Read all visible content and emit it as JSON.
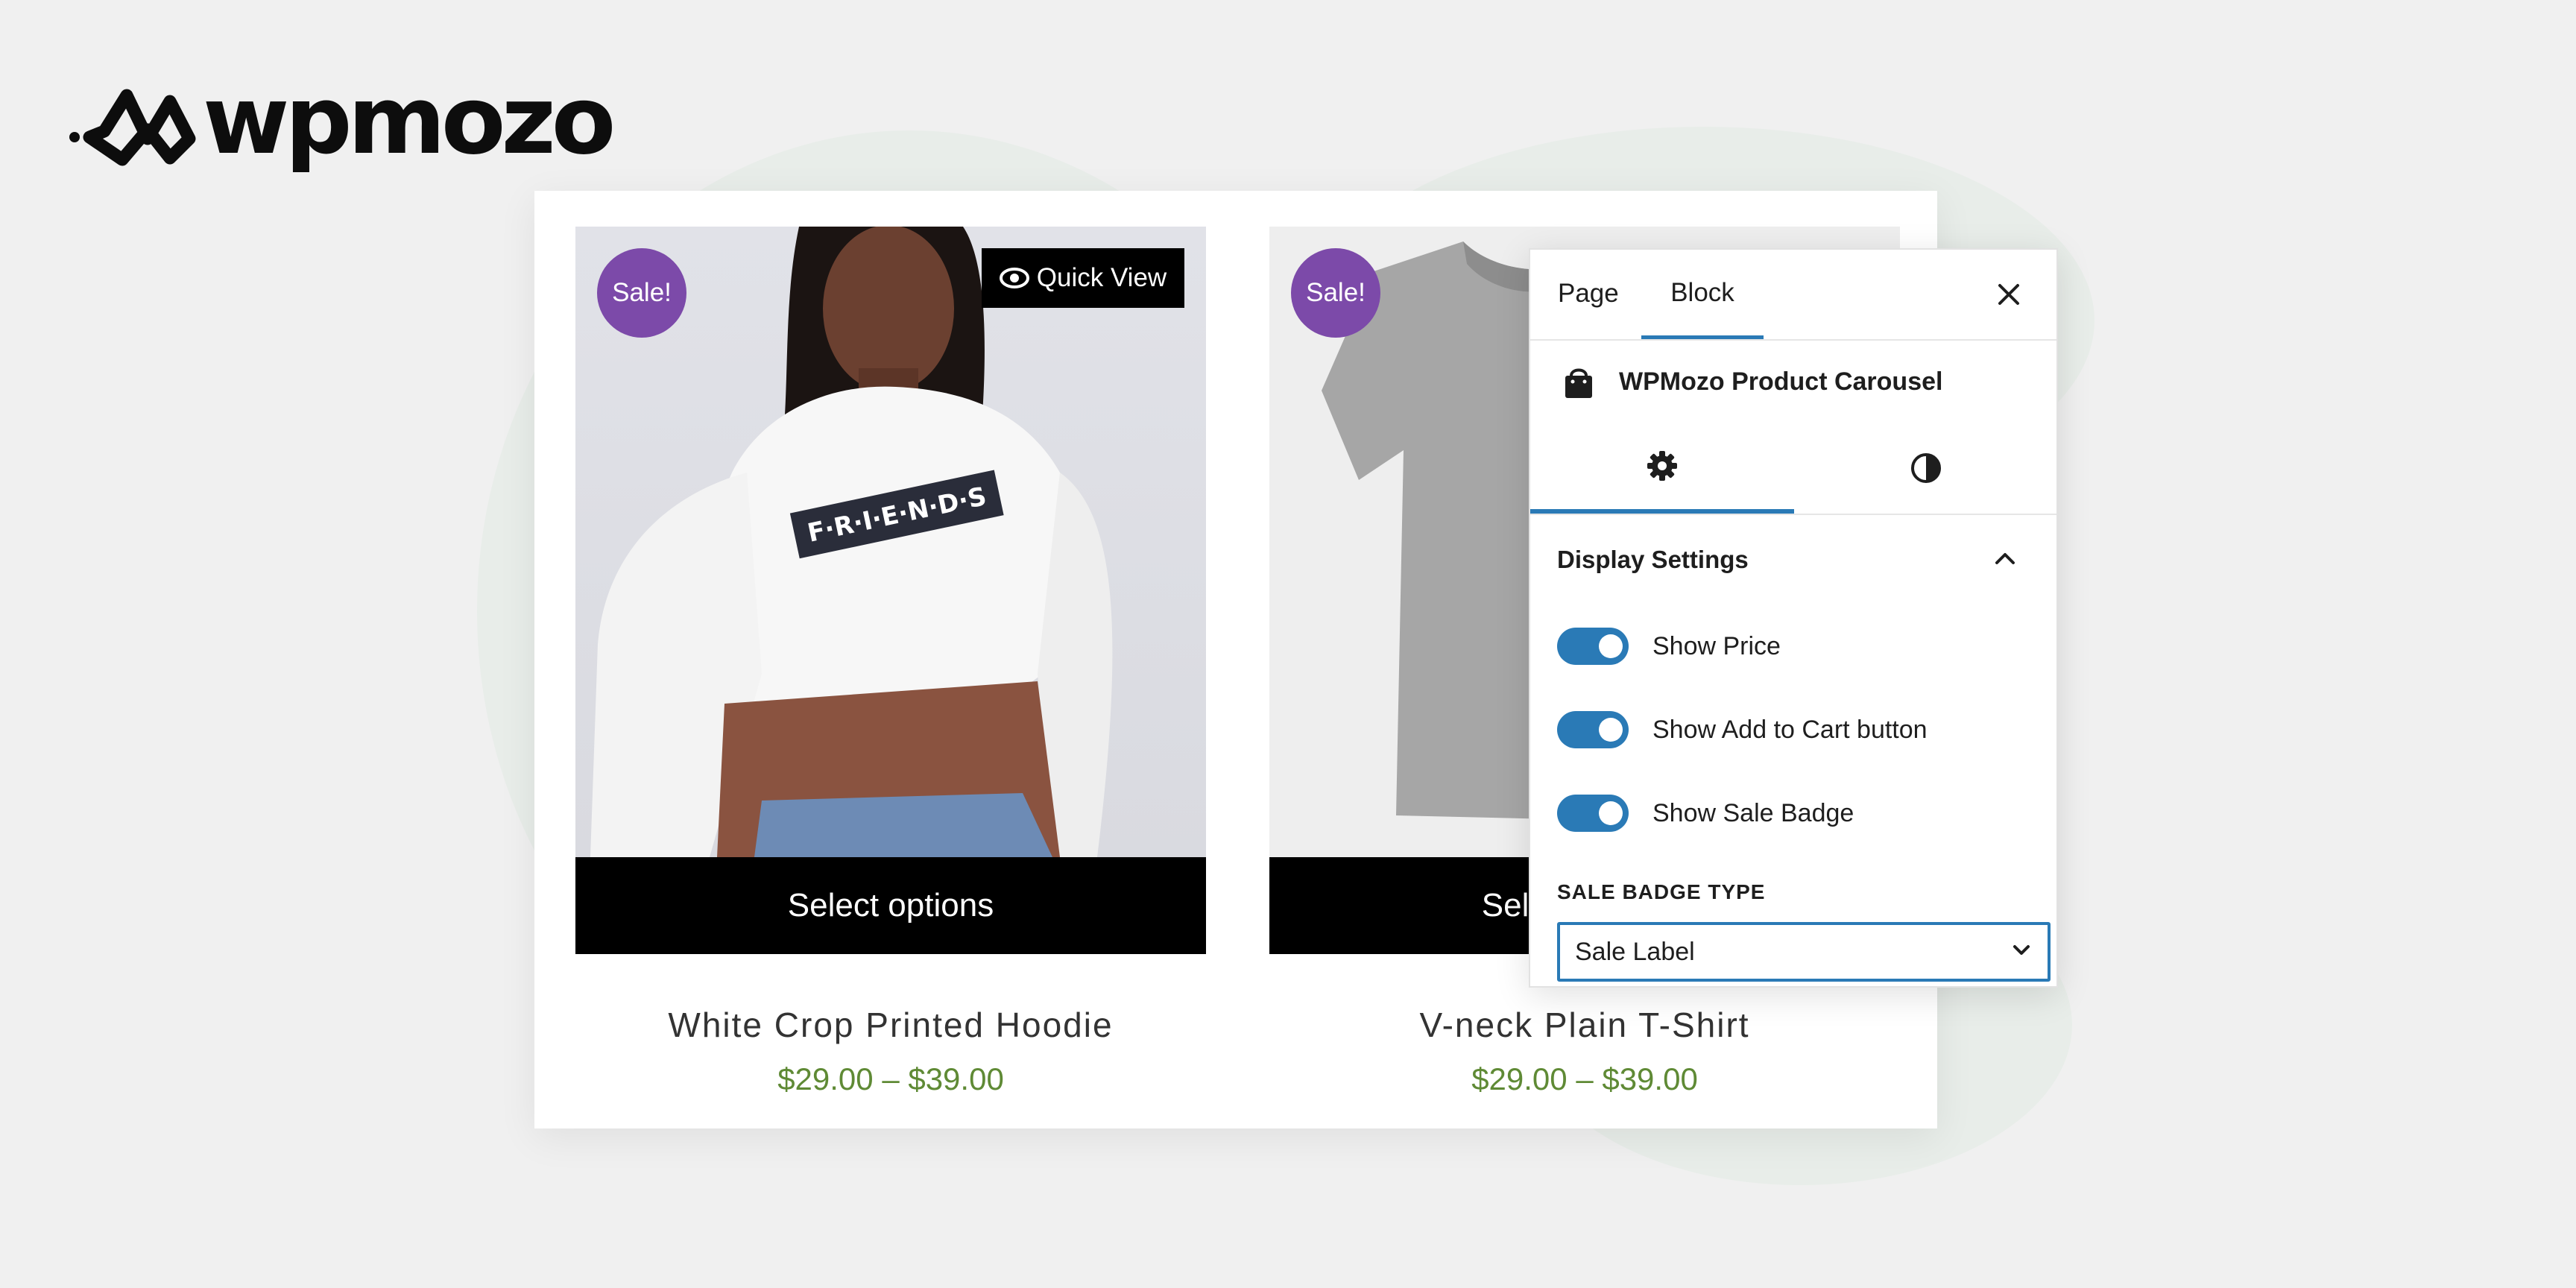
{
  "brand": {
    "name": "wpmozo"
  },
  "products": [
    {
      "badge": "Sale!",
      "quick_view": "Quick View",
      "image_text": "F·R·I·E·N·D·S",
      "button": "Select options",
      "title": "White Crop Printed Hoodie",
      "price": "$29.00 – $39.00"
    },
    {
      "badge": "Sale!",
      "button": "Select options",
      "title": "V-neck Plain T-Shirt",
      "price": "$29.00 – $39.00"
    }
  ],
  "panel": {
    "tabs": [
      "Page",
      "Block"
    ],
    "active_tab": "Block",
    "block_name": "WPMozo Product Carousel",
    "section_title": "Display Settings",
    "toggles": [
      {
        "label": "Show Price",
        "on": true
      },
      {
        "label": "Show Add to Cart button",
        "on": true
      },
      {
        "label": "Show Sale Badge",
        "on": true
      }
    ],
    "sale_badge_type_label": "SALE BADGE TYPE",
    "sale_badge_type_value": "Sale Label"
  },
  "colors": {
    "accent": "#2a7ab6",
    "sale_badge": "#7c4aa9",
    "price": "#5f8a35"
  }
}
